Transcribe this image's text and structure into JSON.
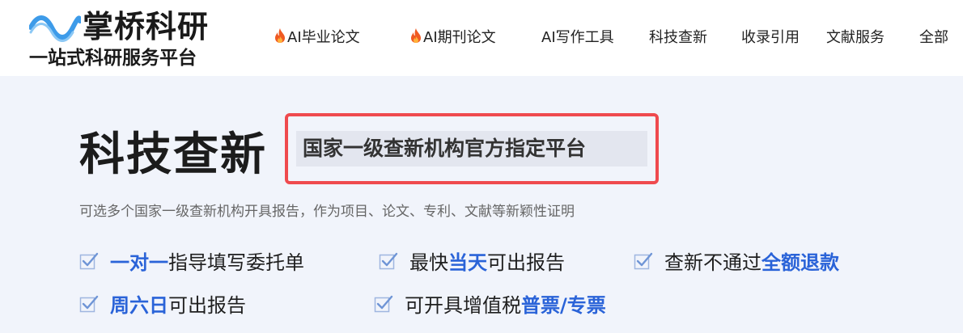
{
  "brand": {
    "name": "掌桥科研",
    "slogan": "一站式科研服务平台",
    "accent_color": "#2a63d8",
    "wave_color": "#3d9be9"
  },
  "nav": {
    "items": [
      {
        "label": "AI毕业论文",
        "icon": "fire-icon"
      },
      {
        "label": "AI期刊论文",
        "icon": "fire-icon"
      },
      {
        "label": "AI写作工具"
      },
      {
        "label": "科技查新"
      },
      {
        "label": "收录引用"
      },
      {
        "label": "文献服务"
      },
      {
        "label": "全部"
      }
    ]
  },
  "hero": {
    "title": "科技查新",
    "tagline": "国家一级查新机构官方指定平台",
    "highlight_border_color": "#ef4a4e",
    "description": "可选多个国家一级查新机构开具报告，作为项目、论文、专利、文献等新颖性证明",
    "features": [
      {
        "highlight_prefix": "一对一",
        "text": "指导填写委托单",
        "highlight_suffix": ""
      },
      {
        "highlight_prefix": "",
        "text": "最快",
        "highlight_suffix": "当天",
        "after": "可出报告"
      },
      {
        "highlight_prefix": "",
        "text": "查新不通过",
        "highlight_suffix": "全额退款"
      },
      {
        "highlight_prefix": "周六日",
        "text": "可出报告",
        "highlight_suffix": ""
      },
      {
        "highlight_prefix": "",
        "text": "可开具增值税",
        "highlight_suffix": "普票/专票"
      }
    ]
  }
}
